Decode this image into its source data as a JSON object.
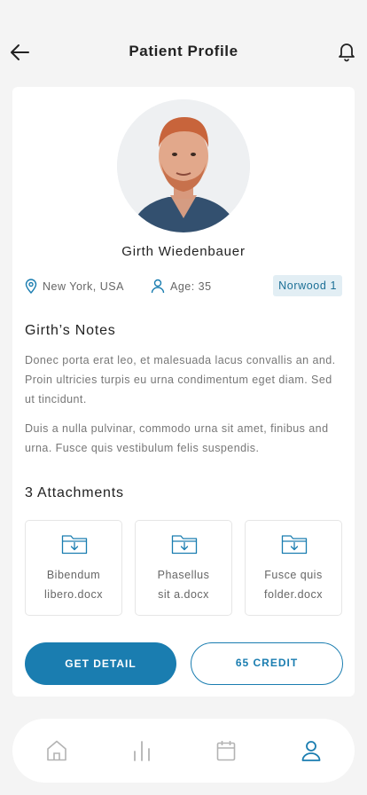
{
  "header": {
    "title": "Patient Profile"
  },
  "patient": {
    "name": "Girth Wiedenbauer",
    "location": "New York, USA",
    "age": "Age: 35",
    "badge": "Norwood 1"
  },
  "notes": {
    "title": "Girth’s Notes",
    "paragraphs": [
      "Donec porta erat leo, et malesuada lacus convallis an and. Proin ultricies turpis eu urna  condimentum  eget diam. Sed ut tincidunt.",
      "Duis a nulla pulvinar, commodo urna sit amet, finibus and urna. Fusce quis vestibulum felis suspendis."
    ]
  },
  "attachments": {
    "title": "3 Attachments",
    "items": [
      {
        "line1": "Bibendum",
        "line2": "libero.docx"
      },
      {
        "line1": "Phasellus",
        "line2": "sit a.docx"
      },
      {
        "line1": "Fusce quis",
        "line2": "folder.docx"
      }
    ]
  },
  "actions": {
    "primary": "GET DETAIL",
    "secondary": "65 CREDIT"
  },
  "colors": {
    "accent": "#1a7db0",
    "badge_bg": "#e2eef4"
  },
  "tabbar": {
    "icons": [
      "home-icon",
      "chart-icon",
      "calendar-icon",
      "user-icon"
    ],
    "active": "user-icon"
  }
}
